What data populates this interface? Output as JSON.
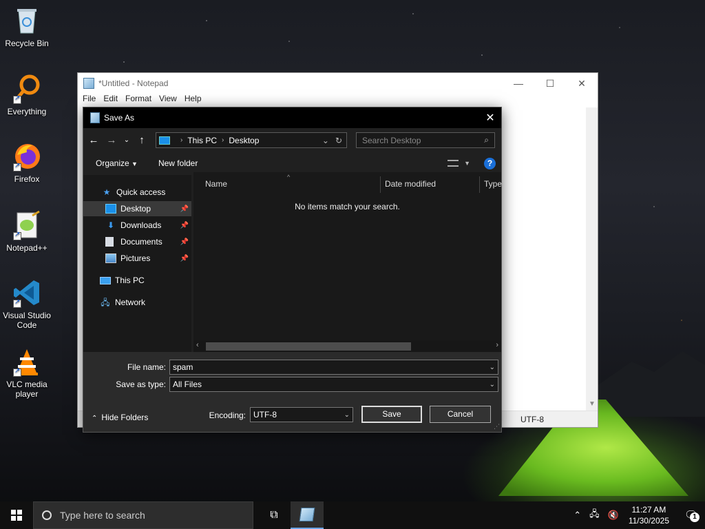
{
  "desktop": {
    "icons": [
      {
        "label": "Recycle Bin",
        "icon": "recycle-bin-icon"
      },
      {
        "label": "Everything",
        "icon": "everything-icon"
      },
      {
        "label": "Firefox",
        "icon": "firefox-icon"
      },
      {
        "label": "Notepad++",
        "icon": "notepad-plus-plus-icon"
      },
      {
        "label": "Visual Studio Code",
        "icon": "vscode-icon"
      },
      {
        "label": "VLC media player",
        "icon": "vlc-icon"
      }
    ]
  },
  "notepad": {
    "title": "*Untitled - Notepad",
    "menu": [
      "File",
      "Edit",
      "Format",
      "View",
      "Help"
    ],
    "status_encoding": "UTF-8",
    "controls": {
      "minimize": "—",
      "maximize": "☐",
      "close": "✕"
    }
  },
  "dialog": {
    "title": "Save As",
    "close": "✕",
    "address": {
      "segments": [
        "This PC",
        "Desktop"
      ]
    },
    "search_placeholder": "Search Desktop",
    "toolbar": {
      "organize": "Organize",
      "new_folder": "New folder",
      "help": "?"
    },
    "nav_pane": {
      "items": [
        {
          "label": "Quick access",
          "icon": "star-icon"
        },
        {
          "label": "Desktop",
          "icon": "desktop-folder-icon",
          "selected": true,
          "pinned": true
        },
        {
          "label": "Downloads",
          "icon": "downloads-icon",
          "pinned": true
        },
        {
          "label": "Documents",
          "icon": "documents-icon",
          "pinned": true
        },
        {
          "label": "Pictures",
          "icon": "pictures-icon",
          "pinned": true
        },
        {
          "label": "This PC",
          "icon": "this-pc-icon"
        },
        {
          "label": "Network",
          "icon": "network-icon"
        }
      ]
    },
    "columns": [
      "Name",
      "Date modified",
      "Type"
    ],
    "empty_message": "No items match your search.",
    "file_name_label": "File name:",
    "file_name_value": "spam",
    "save_type_label": "Save as type:",
    "save_type_value": "All Files",
    "encoding_label": "Encoding:",
    "encoding_value": "UTF-8",
    "save_button": "Save",
    "cancel_button": "Cancel",
    "hide_folders": "Hide Folders"
  },
  "taskbar": {
    "search_placeholder": "Type here to search",
    "time": "11:27 AM",
    "date": "11/30/2025",
    "notification_count": "1"
  },
  "colors": {
    "dialog_bg": "#202020",
    "accent": "#1a6fd8",
    "taskbar": "#101010"
  }
}
